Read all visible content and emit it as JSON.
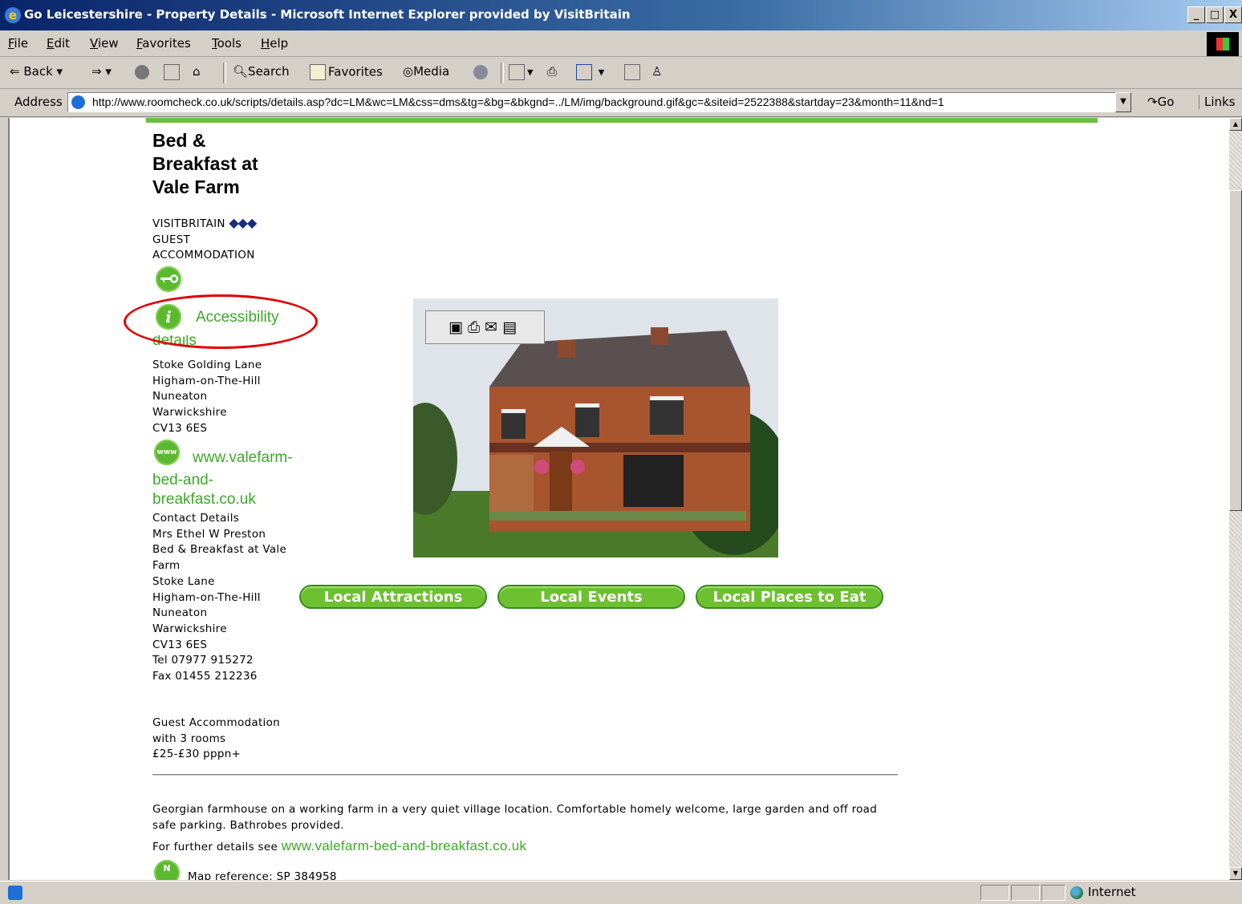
{
  "window": {
    "title": "Go Leicestershire - Property Details - Microsoft Internet Explorer provided by VisitBritain",
    "controls": [
      "_",
      "□",
      "X"
    ]
  },
  "menu": [
    "File",
    "Edit",
    "View",
    "Favorites",
    "Tools",
    "Help"
  ],
  "toolbar": {
    "back": "Back",
    "search": "Search",
    "favorites": "Favorites",
    "media": "Media"
  },
  "address": {
    "label": "Address",
    "url": "http://www.roomcheck.co.uk/scripts/details.asp?dc=LM&wc=LM&css=dms&tg=&bg=&bkgnd=../LM/img/background.gif&gc=&siteid=2522388&startday=23&month=11&nd=1",
    "go": "Go",
    "links": "Links"
  },
  "property": {
    "name_lines": [
      "Bed &",
      "Breakfast at",
      "Vale Farm"
    ],
    "rating_label": "VISITBRITAIN",
    "rating_diamonds": "◆◆◆",
    "category_lines": [
      "GUEST",
      "ACCOMMODATION"
    ],
    "accessibility_link_line1": "Accessibility",
    "accessibility_link_line2": "details",
    "address_lines": [
      "Stoke Golding Lane",
      "Higham-on-The-Hill",
      "Nuneaton",
      "Warwickshire",
      "CV13 6ES"
    ],
    "website_lines": [
      "www.valefarm-",
      "bed-and-",
      "breakfast.co.uk"
    ],
    "contact_heading": "Contact Details",
    "contact_lines": [
      "Mrs Ethel W Preston",
      "Bed & Breakfast at Vale",
      "Farm",
      "Stoke Lane",
      "Higham-on-The-Hill",
      "Nuneaton",
      "Warwickshire",
      "CV13 6ES",
      "Tel  07977 915272",
      "Fax  01455 212236"
    ],
    "summary_lines": [
      "Guest Accommodation",
      "with 3 rooms",
      "£25-£30 pppn+"
    ],
    "description_line1": "Georgian farmhouse on a working farm in a very quiet village location. Comfortable homely welcome, large garden and off road",
    "description_line2": "safe parking. Bathrobes provided.",
    "further_details_prefix": "For further details see",
    "further_details_link": "www.valefarm-bed-and-breakfast.co.uk",
    "map_reference": "Map reference: SP 384958"
  },
  "nav_buttons": [
    "Local Attractions",
    "Local Events",
    "Local Places to Eat"
  ],
  "icons": {
    "key": "key-icon",
    "info": "info-icon",
    "www": "www",
    "map": "N"
  },
  "status": {
    "zone": "Internet"
  },
  "colors": {
    "accent_green": "#6dc02f",
    "link_green": "#3ea82a",
    "diamond_blue": "#1a2c80",
    "annotation_red": "#e00000"
  }
}
